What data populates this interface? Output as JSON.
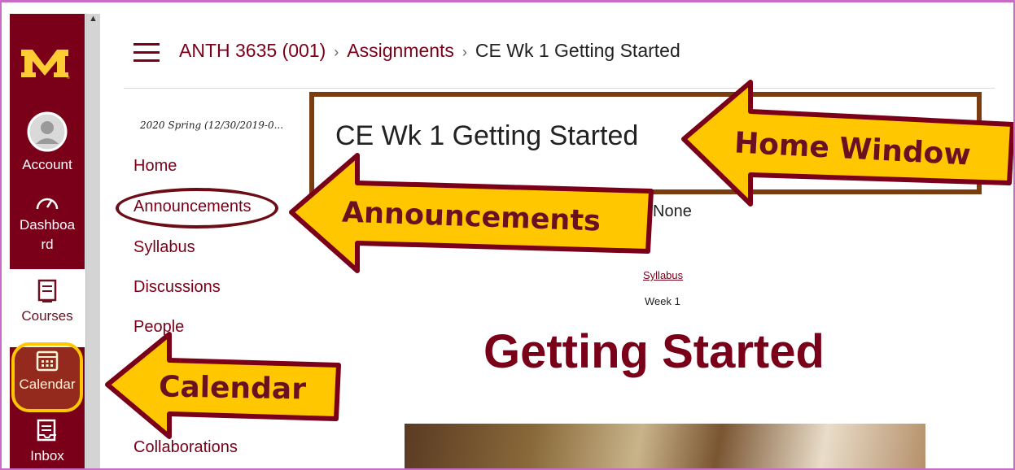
{
  "breadcrumb": {
    "course": "ANTH 3635 (001)",
    "section": "Assignments",
    "current": "CE Wk 1 Getting Started"
  },
  "global_nav": {
    "account": "Account",
    "dashboard": "Dashboa rd",
    "courses": "Courses",
    "calendar": "Calendar",
    "inbox": "Inbox"
  },
  "course_nav": {
    "term": "2020 Spring (12/30/2019-0...",
    "items": [
      "Home",
      "Announcements",
      "Syllabus",
      "Discussions",
      "People",
      "Collaborations"
    ]
  },
  "content": {
    "title": "CE Wk 1 Getting Started",
    "none_text": "None",
    "syllabus_link": "Syllabus",
    "week": "Week 1",
    "heading": "Getting Started"
  },
  "annotations": {
    "home_window": "Home Window",
    "announcements": "Announcements",
    "calendar": "Calendar"
  },
  "colors": {
    "maroon": "#7a0019",
    "gold": "#ffc700",
    "frame": "#c86cc8"
  }
}
